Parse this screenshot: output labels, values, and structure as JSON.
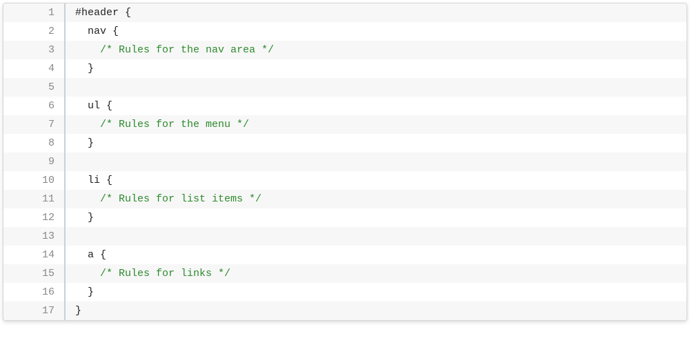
{
  "code": {
    "lines": [
      {
        "num": "1",
        "indent": 0,
        "tokens": [
          {
            "cls": "tok-selector",
            "t": "#header "
          },
          {
            "cls": "tok-punct",
            "t": "{"
          }
        ]
      },
      {
        "num": "2",
        "indent": 1,
        "tokens": [
          {
            "cls": "tok-selector",
            "t": "nav "
          },
          {
            "cls": "tok-punct",
            "t": "{"
          }
        ]
      },
      {
        "num": "3",
        "indent": 2,
        "tokens": [
          {
            "cls": "tok-comment",
            "t": "/* Rules for the nav area */"
          }
        ]
      },
      {
        "num": "4",
        "indent": 1,
        "tokens": [
          {
            "cls": "tok-punct",
            "t": "}"
          }
        ]
      },
      {
        "num": "5",
        "indent": 0,
        "tokens": []
      },
      {
        "num": "6",
        "indent": 1,
        "tokens": [
          {
            "cls": "tok-selector",
            "t": "ul "
          },
          {
            "cls": "tok-punct",
            "t": "{"
          }
        ]
      },
      {
        "num": "7",
        "indent": 2,
        "tokens": [
          {
            "cls": "tok-comment",
            "t": "/* Rules for the menu */"
          }
        ]
      },
      {
        "num": "8",
        "indent": 1,
        "tokens": [
          {
            "cls": "tok-punct",
            "t": "}"
          }
        ]
      },
      {
        "num": "9",
        "indent": 0,
        "tokens": []
      },
      {
        "num": "10",
        "indent": 1,
        "tokens": [
          {
            "cls": "tok-selector",
            "t": "li "
          },
          {
            "cls": "tok-punct",
            "t": "{"
          }
        ]
      },
      {
        "num": "11",
        "indent": 2,
        "tokens": [
          {
            "cls": "tok-comment",
            "t": "/* Rules for list items */"
          }
        ]
      },
      {
        "num": "12",
        "indent": 1,
        "tokens": [
          {
            "cls": "tok-punct",
            "t": "}"
          }
        ]
      },
      {
        "num": "13",
        "indent": 0,
        "tokens": []
      },
      {
        "num": "14",
        "indent": 1,
        "tokens": [
          {
            "cls": "tok-selector",
            "t": "a "
          },
          {
            "cls": "tok-punct",
            "t": "{"
          }
        ]
      },
      {
        "num": "15",
        "indent": 2,
        "tokens": [
          {
            "cls": "tok-comment",
            "t": "/* Rules for links */"
          }
        ]
      },
      {
        "num": "16",
        "indent": 1,
        "tokens": [
          {
            "cls": "tok-punct",
            "t": "}"
          }
        ]
      },
      {
        "num": "17",
        "indent": 0,
        "tokens": [
          {
            "cls": "tok-punct",
            "t": "}"
          }
        ]
      }
    ]
  }
}
